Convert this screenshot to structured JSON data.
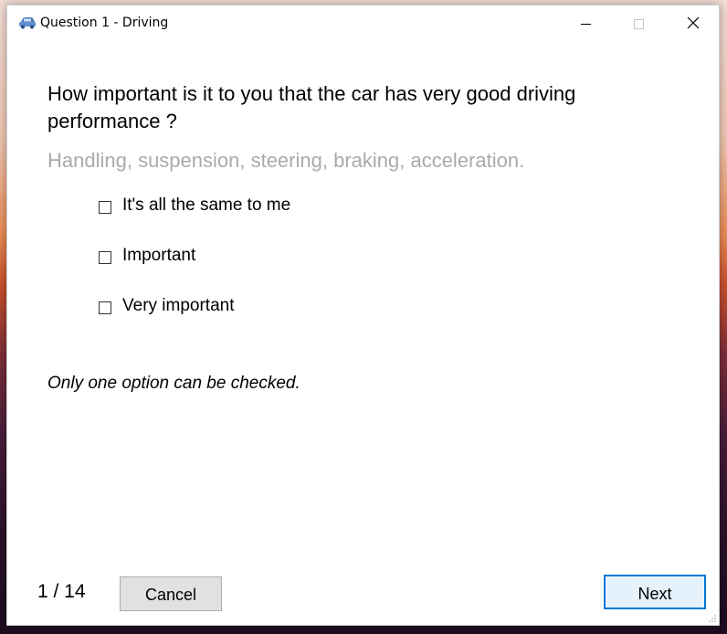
{
  "window": {
    "title": "Question 1 - Driving",
    "app_icon": "car-icon"
  },
  "question": {
    "text": "How important is it to you that the car has very good driving performance ?",
    "hint": "Handling, suspension, steering, braking, acceleration."
  },
  "options": [
    {
      "label": "It's all the same to me",
      "checked": false
    },
    {
      "label": "Important",
      "checked": false
    },
    {
      "label": "Very important",
      "checked": false
    }
  ],
  "note": "Only one option can be checked.",
  "footer": {
    "counter": "1 / 14",
    "cancel_label": "Cancel",
    "next_label": "Next"
  },
  "colors": {
    "accent": "#0078d7",
    "hint_text": "#aaaaaa",
    "button_face": "#e1e1e1"
  }
}
